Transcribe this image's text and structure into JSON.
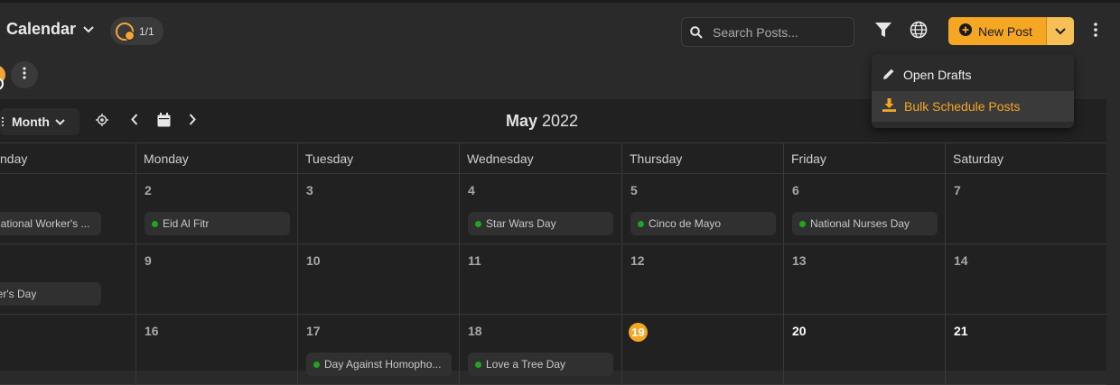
{
  "header": {
    "title": "Calendar",
    "account_count": "1/1",
    "search_placeholder": "Search Posts...",
    "new_post_label": "New Post"
  },
  "dropdown": {
    "items": [
      {
        "label": "Open Drafts",
        "icon": "pencil-icon",
        "active": false
      },
      {
        "label": "Bulk Schedule Posts",
        "icon": "download-icon",
        "active": true
      }
    ]
  },
  "calendar": {
    "view": "Month",
    "month": "May",
    "year": "2022",
    "weekdays": [
      "nday",
      "Monday",
      "Tuesday",
      "Wednesday",
      "Thursday",
      "Friday",
      "Saturday"
    ],
    "weeks": [
      [
        {
          "day": "",
          "event": "International Worker's ..."
        },
        {
          "day": "2",
          "event": "Eid Al Fitr"
        },
        {
          "day": "3",
          "event": ""
        },
        {
          "day": "4",
          "event": "Star Wars Day"
        },
        {
          "day": "5",
          "event": "Cinco de Mayo"
        },
        {
          "day": "6",
          "event": "National Nurses Day"
        },
        {
          "day": "7",
          "event": ""
        }
      ],
      [
        {
          "day": "",
          "event": "Mother's Day"
        },
        {
          "day": "9",
          "event": ""
        },
        {
          "day": "10",
          "event": ""
        },
        {
          "day": "11",
          "event": ""
        },
        {
          "day": "12",
          "event": ""
        },
        {
          "day": "13",
          "event": ""
        },
        {
          "day": "14",
          "event": ""
        }
      ],
      [
        {
          "day": "",
          "event": ""
        },
        {
          "day": "16",
          "event": ""
        },
        {
          "day": "17",
          "event": "Day Against Homopho..."
        },
        {
          "day": "18",
          "event": "Love a Tree Day"
        },
        {
          "day": "19",
          "event": "",
          "today": true
        },
        {
          "day": "20",
          "event": "",
          "bright": true
        },
        {
          "day": "21",
          "event": "",
          "bright": true
        }
      ]
    ]
  },
  "colors": {
    "accent": "#f5a623",
    "event_dot": "#1fa51f",
    "background": "#2a2a2a",
    "calendar_bg": "#212121"
  }
}
